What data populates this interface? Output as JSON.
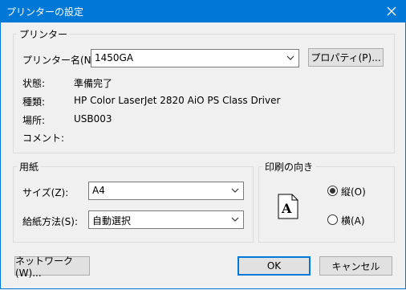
{
  "window": {
    "title": "プリンターの設定"
  },
  "printer_group": {
    "label": "プリンター",
    "name_label": "プリンター名(N):",
    "name_value": "1450GA",
    "properties_button": "プロパティ(P)...",
    "status_label": "状態:",
    "status_value": "準備完了",
    "type_label": "種類:",
    "type_value": "HP Color LaserJet 2820 AiO PS Class Driver",
    "where_label": "場所:",
    "where_value": "USB003",
    "comment_label": "コメント:",
    "comment_value": ""
  },
  "paper_group": {
    "label": "用紙",
    "size_label": "サイズ(Z):",
    "size_value": "A4",
    "source_label": "給紙方法(S):",
    "source_value": "自動選択"
  },
  "orientation_group": {
    "label": "印刷の向き",
    "page_glyph": "A",
    "portrait_label": "縦(O)",
    "landscape_label": "横(A)",
    "selected": "portrait"
  },
  "footer": {
    "network_button": "ネットワーク(W)...",
    "ok_button": "OK",
    "cancel_button": "キャンセル"
  },
  "colors": {
    "accent": "#0078d7",
    "window_bg": "#f0f0f0"
  }
}
